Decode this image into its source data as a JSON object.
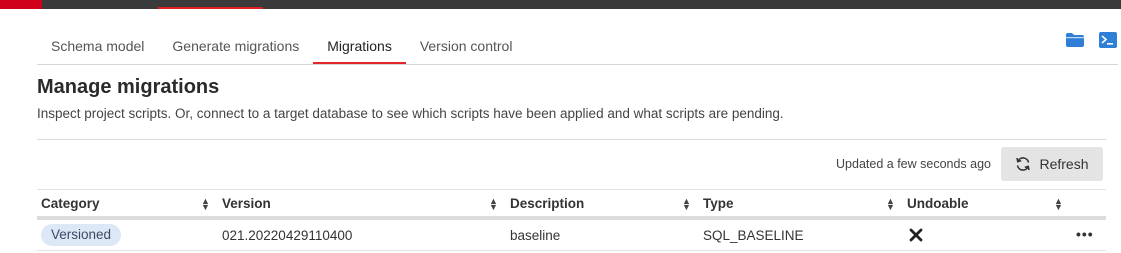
{
  "tabs": [
    {
      "label": "Schema model",
      "active": false
    },
    {
      "label": "Generate migrations",
      "active": false
    },
    {
      "label": "Migrations",
      "active": true
    },
    {
      "label": "Version control",
      "active": false
    }
  ],
  "icons": {
    "folder": "folder-icon",
    "terminal": "terminal-icon",
    "refresh": "refresh-icon",
    "sort": "sort-icon",
    "undoable_false": "x-icon",
    "more": "more-icon"
  },
  "page": {
    "title": "Manage migrations",
    "subtitle": "Inspect project scripts. Or, connect to a target database to see which scripts have been applied and what scripts are pending."
  },
  "status": {
    "updated": "Updated a few seconds ago",
    "refresh_label": "Refresh"
  },
  "table": {
    "columns": [
      "Category",
      "Version",
      "Description",
      "Type",
      "Undoable"
    ],
    "rows": [
      {
        "category": "Versioned",
        "version": "021.20220429110400",
        "description": "baseline",
        "type": "SQL_BASELINE",
        "undoable": false,
        "more": "•••"
      }
    ]
  },
  "colors": {
    "accent": "#e3262b",
    "topbar": "#3a3a3a",
    "icon_blue": "#2f7fd6",
    "badge_bg": "#dde8f7"
  }
}
